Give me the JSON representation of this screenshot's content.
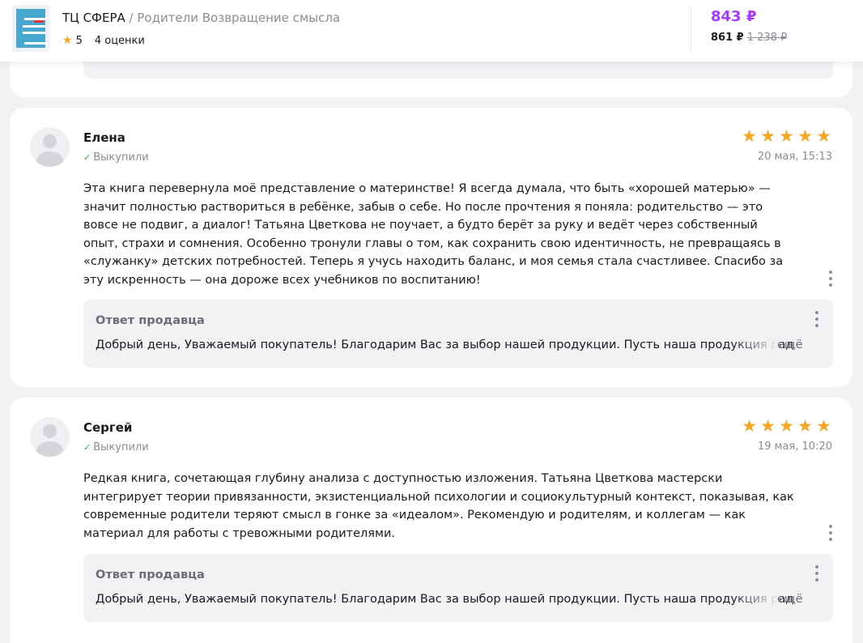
{
  "header": {
    "brand": "ТЦ СФЕРА",
    "separator": " / ",
    "product": "Родители Возвращение смысла",
    "rating": "5",
    "ratings_count": "4 оценки",
    "price": "843 ₽",
    "price_alt": "861 ₽",
    "price_old": "1 238 ₽",
    "colors": {
      "price_accent": "#a73afd",
      "star": "#f5a623"
    }
  },
  "reviews": [
    {
      "author": "Елена",
      "status": "Выкупили",
      "rating": 5,
      "date": "20 мая, 15:13",
      "text": "Эта книга перевернула моё представление о материнстве! Я всегда думала, что быть «хорошей матерью» — значит полностью раствориться в ребёнке, забыв о себе. Но после прочтения я поняла: родительство — это вовсе не подвиг, а диалог! Татьяна Цветкова не поучает, а будто берёт за руку и ведёт через собственный опыт, страхи и сомнения. Особенно тронули главы о том, как сохранить свою идентичность, не превращаясь в «служанку» детских потребностей. Теперь я учусь находить баланс, и моя семья стала счастливее. Спасибо за эту искренность — она дороже всех учебников по воспитанию!",
      "reply_title": "Ответ продавца",
      "reply_text": "Добрый день, Уважаемый покупатель! Благодарим Вас за выбор нашей продукции. Пусть наша продукция радует Вас.",
      "reply_more": "ещё"
    },
    {
      "author": "Сергей",
      "status": "Выкупили",
      "rating": 5,
      "date": "19 мая, 10:20",
      "text": "Редкая книга, сочетающая глубину анализа с доступностью изложения. Татьяна Цветкова мастерски интегрирует теории привязанности, экзистенциальной психологии и социокультурный контекст, показывая, как современные родители теряют смысл в гонке за «идеалом». Рекомендую и родителям, и коллегам — как материал для работы с тревожными родителями.",
      "reply_title": "Ответ продавца",
      "reply_text": "Добрый день, Уважаемый покупатель! Благодарим Вас за выбор нашей продукции. Пусть наша продукция радует Вас.",
      "reply_more": "ещё"
    }
  ],
  "icons": {
    "star": "★",
    "check": "✓"
  }
}
